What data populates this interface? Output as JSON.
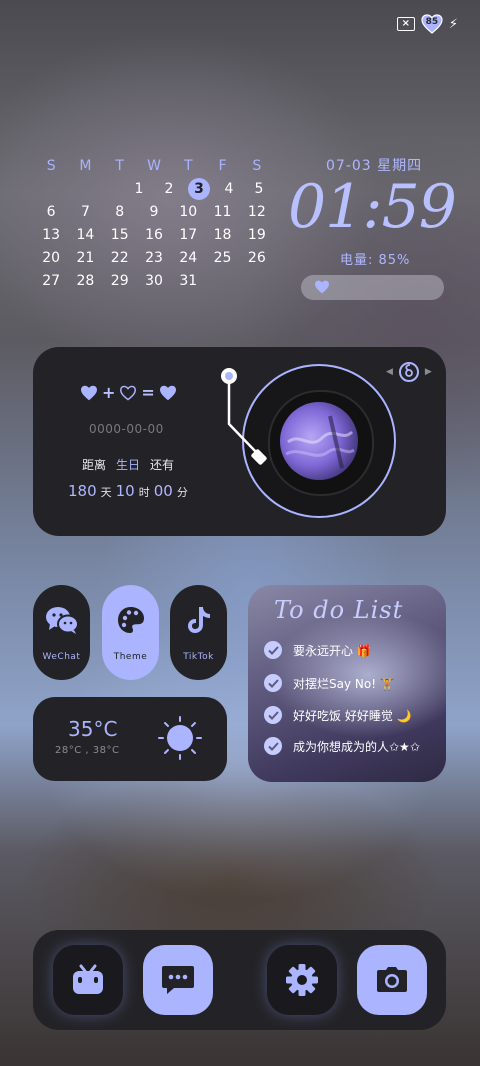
{
  "status": {
    "battery_level": "85"
  },
  "calendar": {
    "weekdays": [
      "S",
      "M",
      "T",
      "W",
      "T",
      "F",
      "S"
    ],
    "weeks": [
      [
        "",
        "",
        "",
        "1",
        "2",
        "3",
        "4",
        "5"
      ],
      [
        "6",
        "7",
        "8",
        "9",
        "10",
        "11",
        "12"
      ],
      [
        "13",
        "14",
        "15",
        "16",
        "17",
        "18",
        "19"
      ],
      [
        "20",
        "21",
        "22",
        "23",
        "24",
        "25",
        "26"
      ],
      [
        "27",
        "28",
        "29",
        "30",
        "31",
        "",
        ""
      ]
    ],
    "today": "3"
  },
  "clock": {
    "date": "07-03 星期四",
    "time": "01:59",
    "battery_text": "电量: 85%"
  },
  "countdown": {
    "equation": [
      "+",
      "="
    ],
    "date_placeholder": "0000-00-00",
    "label_prefix": "距离",
    "label_event": "生日",
    "label_suffix": "还有",
    "days": "180",
    "days_unit": "天",
    "hours": "10",
    "hours_unit": "时",
    "minutes": "00",
    "minutes_unit": "分"
  },
  "apps": [
    {
      "label": "WeChat",
      "icon": "wechat-icon"
    },
    {
      "label": "Theme",
      "icon": "palette-icon"
    },
    {
      "label": "TikTok",
      "icon": "tiktok-icon"
    }
  ],
  "weather": {
    "temp": "35°C",
    "low": "28°C",
    "high": "38°C",
    "icon": "sun-icon"
  },
  "todo": {
    "title": "To do List",
    "items": [
      "要永远开心 🎁",
      "对摆烂Say No! 🏋",
      "好好吃饭 好好睡觉 🌙",
      "成为你想成为的人✩★✩"
    ]
  },
  "dock": {
    "icons": [
      "bilibili-icon",
      "messages-icon",
      "settings-icon",
      "camera-icon"
    ]
  },
  "colors": {
    "accent": "#aab4ff",
    "widget_bg": "#232327"
  }
}
